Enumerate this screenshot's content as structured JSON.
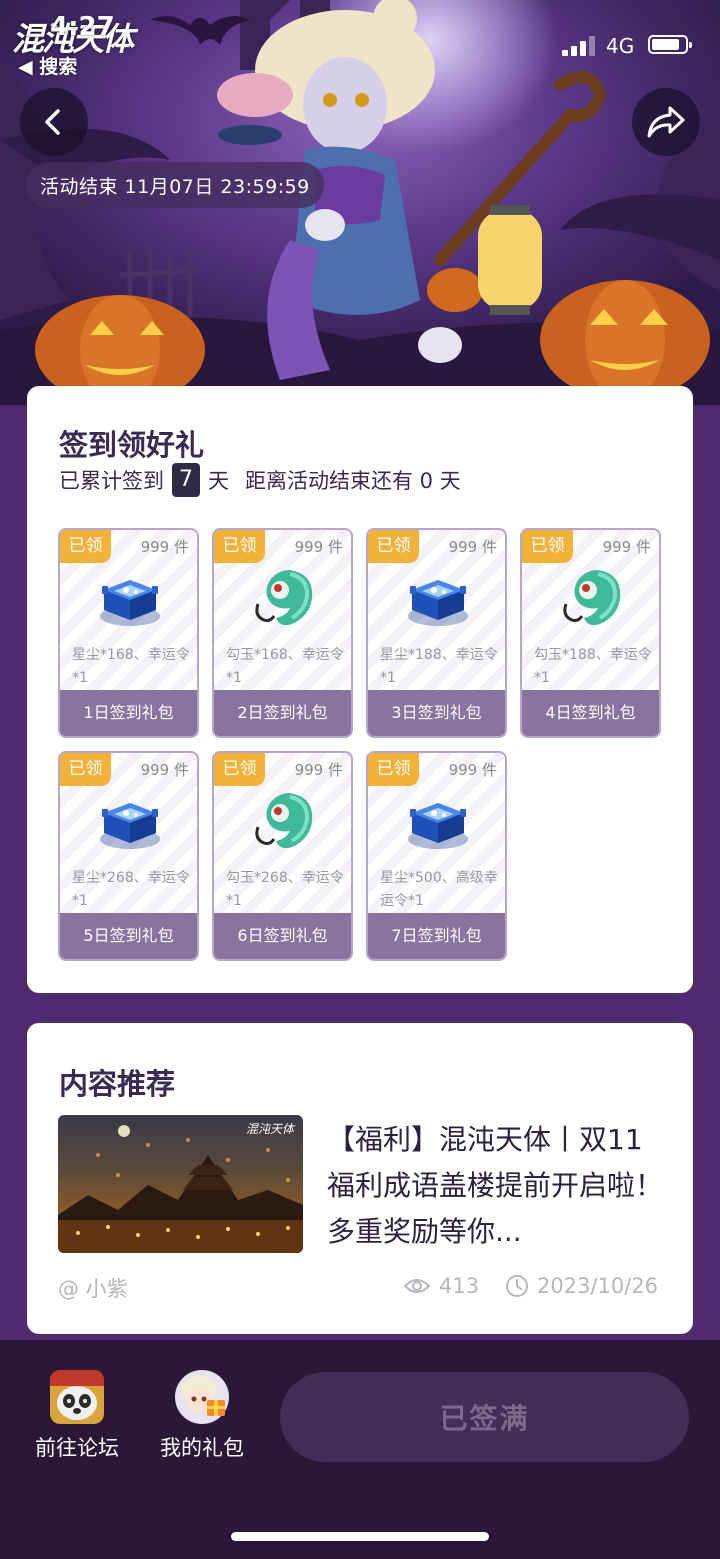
{
  "status_bar": {
    "app_logo_text": "混沌天体",
    "time": "4:27",
    "back_label": "◀ 搜索",
    "network": "4G",
    "battery_level": 0.85
  },
  "header": {
    "activity_end": "活动结束 11月07日 23:59:59"
  },
  "sign_in": {
    "title": "签到领好礼",
    "summary_prefix": "已累计签到",
    "days": "7",
    "summary_unit": "天",
    "remaining_text": "距离活动结束还有 0 天",
    "gifts": [
      {
        "badge": "已领",
        "stock": "999 件",
        "icon": "star-dust-chest-icon",
        "desc": "星尘*168、幸运令*1",
        "name": "1日签到礼包"
      },
      {
        "badge": "已领",
        "stock": "999 件",
        "icon": "jade-magatama-icon",
        "desc": "勾玉*168、幸运令*1",
        "name": "2日签到礼包"
      },
      {
        "badge": "已领",
        "stock": "999 件",
        "icon": "star-dust-chest-icon",
        "desc": "星尘*188、幸运令*1",
        "name": "3日签到礼包"
      },
      {
        "badge": "已领",
        "stock": "999 件",
        "icon": "jade-magatama-icon",
        "desc": "勾玉*188、幸运令*1",
        "name": "4日签到礼包"
      },
      {
        "badge": "已领",
        "stock": "999 件",
        "icon": "star-dust-chest-icon",
        "desc": "星尘*268、幸运令*1",
        "name": "5日签到礼包"
      },
      {
        "badge": "已领",
        "stock": "999 件",
        "icon": "jade-magatama-icon",
        "desc": "勾玉*268、幸运令*1",
        "name": "6日签到礼包"
      },
      {
        "badge": "已领",
        "stock": "999 件",
        "icon": "star-dust-chest-icon",
        "desc": "星尘*500、高级幸运令*1",
        "name": "7日签到礼包"
      }
    ]
  },
  "recommend": {
    "title": "内容推荐",
    "thumb_logo": "混沌天体",
    "article_title": "【福利】混沌天体丨双11福利成语盖楼提前开启啦！多重奖励等你...",
    "author": "@ 小紫",
    "views": "413",
    "date": "2023/10/26"
  },
  "bottom_bar": {
    "forum_label": "前往论坛",
    "gifts_label": "我的礼包",
    "signed_label": "已签满"
  },
  "colors": {
    "page_bg": "#4f2a6e",
    "badge": "#f2b23a",
    "gift_name_bg": "#8a739f",
    "bottom_bar": "#2b1737"
  }
}
